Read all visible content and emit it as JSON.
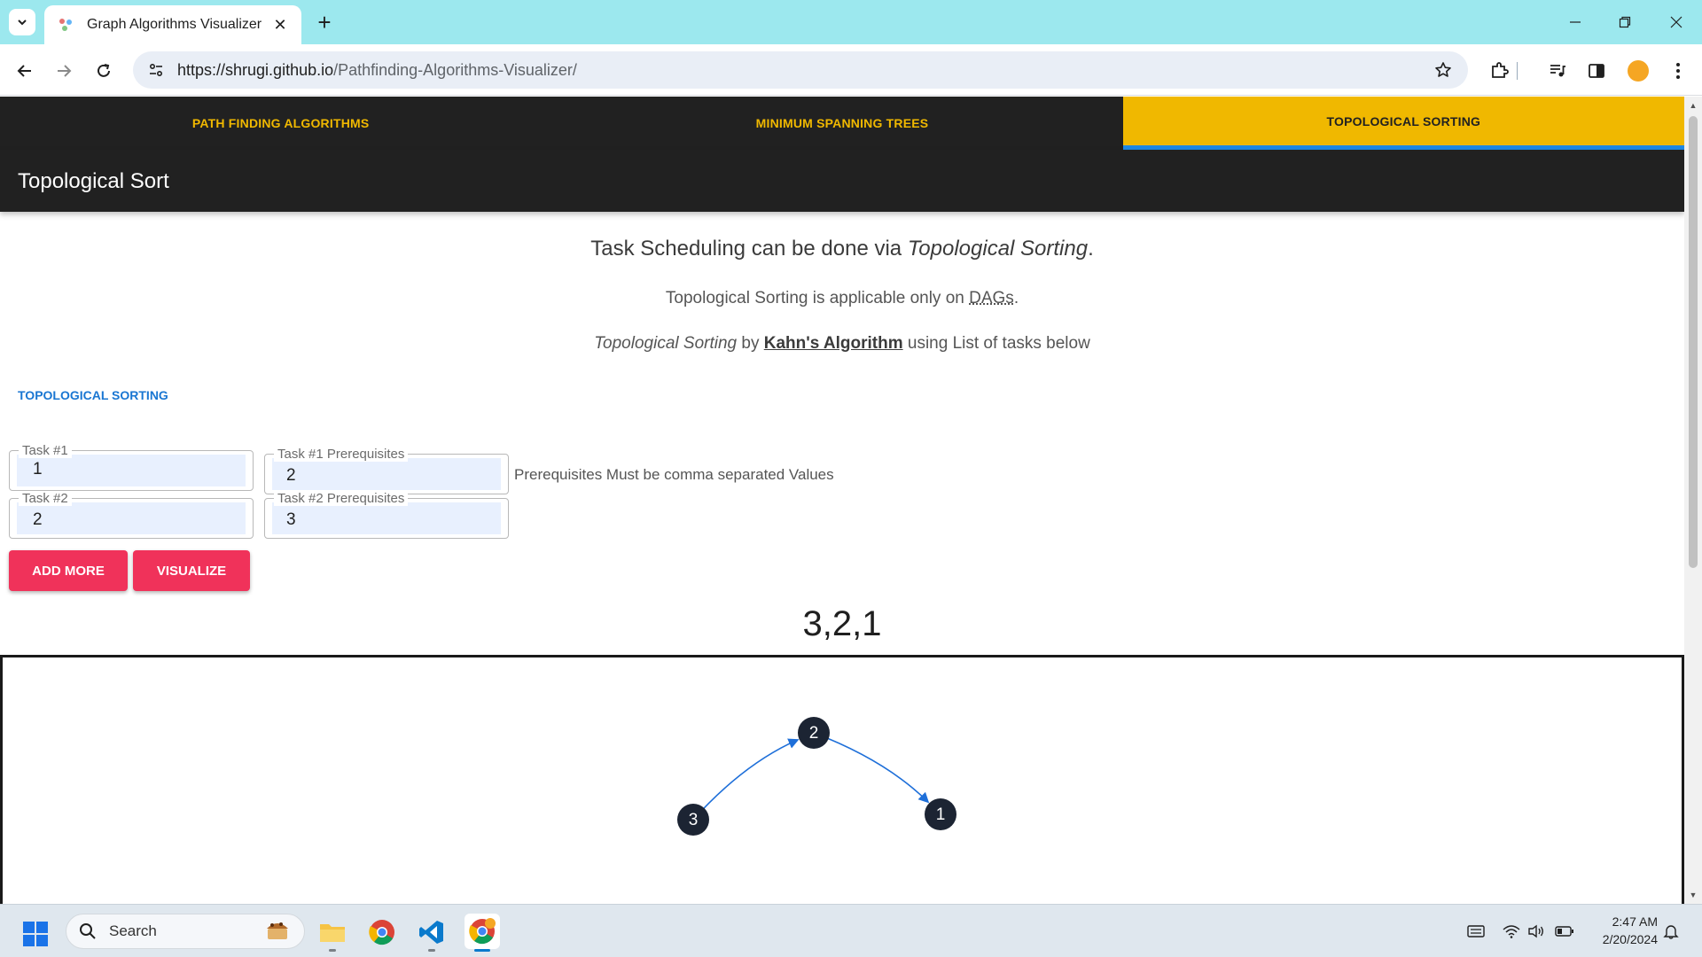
{
  "browser": {
    "tab_title": "Graph Algorithms Visualizer",
    "url_host": "https://shrugi.github.io",
    "url_path": "/Pathfinding-Algorithms-Visualizer/"
  },
  "app": {
    "tabs": [
      {
        "label": "PATH FINDING ALGORITHMS",
        "active": false
      },
      {
        "label": "MINIMUM SPANNING TREES",
        "active": false
      },
      {
        "label": "TOPOLOGICAL SORTING",
        "active": true
      }
    ],
    "title": "Topological Sort",
    "intro": {
      "line1_prefix": "Task Scheduling can be done via ",
      "line1_em": "Topological Sorting",
      "line1_suffix": ".",
      "line2_prefix": "Topological Sorting is applicable only on ",
      "line2_abbr": "DAGs",
      "line2_suffix": ".",
      "line3_em": "Topological Sorting",
      "line3_by": " by ",
      "line3_link": "Kahn's Algorithm",
      "line3_suffix": " using List of tasks below"
    },
    "section_label": "TOPOLOGICAL SORTING",
    "tasks": [
      {
        "task_label": "Task #1",
        "task_value": "1",
        "prereq_label": "Task #1 Prerequisites",
        "prereq_value": "2"
      },
      {
        "task_label": "Task #2",
        "task_value": "2",
        "prereq_label": "Task #2 Prerequisites",
        "prereq_value": "3"
      }
    ],
    "hint": "Prerequisites Must be comma separated Values",
    "buttons": {
      "add_more": "ADD MORE",
      "visualize": "VISUALIZE"
    },
    "result": "3,2,1",
    "graph": {
      "nodes": [
        "2",
        "3",
        "1"
      ],
      "edges": [
        [
          "3",
          "2"
        ],
        [
          "2",
          "1"
        ]
      ],
      "edge_color": "#1e6fd9",
      "node_color": "#1c2433"
    },
    "accent": "#f0b800",
    "button_color": "#f0325a"
  },
  "taskbar": {
    "search_placeholder": "Search",
    "time": "2:47 AM",
    "date": "2/20/2024"
  }
}
